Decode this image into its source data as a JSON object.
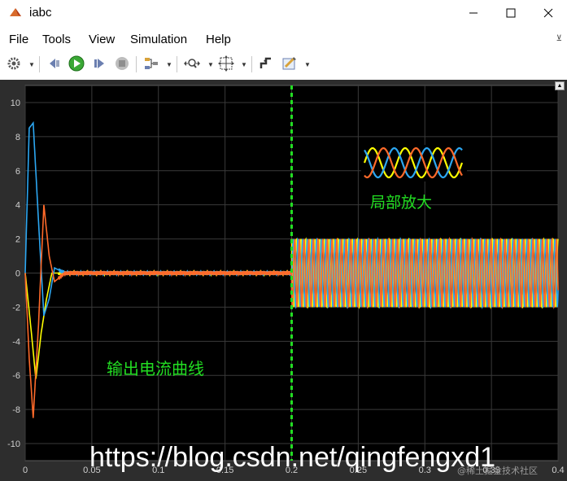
{
  "window": {
    "title": "iabc"
  },
  "menu": {
    "items": [
      "File",
      "Tools",
      "View",
      "Simulation",
      "Help"
    ]
  },
  "toolbar": {
    "buttons": [
      "gear-icon",
      "step-back-icon",
      "run-icon",
      "step-forward-icon",
      "stop-icon",
      "signal-selector-icon",
      "zoom-icon",
      "fit-to-view-icon",
      "triggers-icon",
      "style-icon"
    ]
  },
  "chart_data": {
    "type": "line",
    "xlim": [
      0,
      0.4
    ],
    "ylim": [
      -11,
      11
    ],
    "x_ticks": [
      "0",
      "0.05",
      "0.1",
      "0.15",
      "0.2",
      "0.25",
      "0.3",
      "0.35",
      "0.4"
    ],
    "y_ticks": [
      "10",
      "8",
      "6",
      "4",
      "2",
      "0",
      "-2",
      "-4",
      "-6",
      "-8",
      "-10"
    ],
    "grid": true,
    "series": [
      {
        "color": "#ffff00",
        "x": [
          0,
          0.004,
          0.008,
          0.012,
          0.016,
          0.02,
          0.03,
          0.2,
          0.2005,
          0.4
        ],
        "y": [
          0,
          -3,
          -6.2,
          -3.5,
          -1.5,
          0,
          0,
          0,
          2,
          2
        ],
        "note_amplitude_after_0_2": 2
      },
      {
        "color": "#2ca7f2",
        "x": [
          0,
          0.003,
          0.006,
          0.01,
          0.014,
          0.018,
          0.022,
          0.03,
          0.2,
          0.2005,
          0.4
        ],
        "y": [
          0,
          8.5,
          8.8,
          3,
          -2.5,
          -1.5,
          0.3,
          0,
          0,
          2,
          2
        ],
        "note_amplitude_after_0_2": 2
      },
      {
        "color": "#ff6a2a",
        "x": [
          0,
          0.003,
          0.006,
          0.01,
          0.014,
          0.018,
          0.022,
          0.03,
          0.2,
          0.2005,
          0.4
        ],
        "y": [
          0,
          -5,
          -8.5,
          -3,
          4,
          1,
          -0.5,
          0,
          0,
          -2,
          -2
        ],
        "note_amplitude_after_0_2": 2
      }
    ],
    "marker_x": 0.2,
    "annotations": [
      "输出电流曲线",
      "局部放大"
    ]
  },
  "overlay": {
    "label_output_current": "输出电流曲线",
    "label_zoom": "局部放大",
    "watermark": "https://blog.csdn.net/qingfengxd1",
    "watermark_small": "@稀土掘金技术社区"
  },
  "colors": {
    "yellow": "#ffff00",
    "blue": "#2ca7f2",
    "orange": "#ff6a2a",
    "marker": "#22dd22",
    "plot_bg": "#000000",
    "frame_bg": "#2d2d2d"
  }
}
